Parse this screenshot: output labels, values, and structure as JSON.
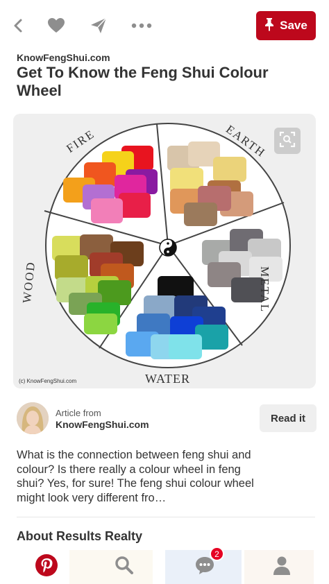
{
  "toolbar": {
    "back_icon": "chevron-left-icon",
    "like_icon": "heart-icon",
    "send_icon": "paper-plane-icon",
    "more_icon": "ellipsis-icon",
    "save_label": "Save",
    "save_icon": "pushpin-icon",
    "brand_color": "#bd081c"
  },
  "pin": {
    "source": "KnowFengShui.com",
    "title": "Get To Know the Feng Shui Colour Wheel",
    "image": {
      "labels": {
        "fire": "FIRE",
        "earth": "EARTH",
        "metal": "METAL",
        "water": "WATER",
        "wood": "WOOD"
      },
      "credit": "(c) KnowFengShui.com",
      "zoom_icon": "visual-search-icon"
    }
  },
  "author": {
    "article_from": "Article from",
    "site": "KnowFengShui.com",
    "read_label": "Read it"
  },
  "description": "What is the connection between feng shui and colour? Is there really a colour wheel in feng shui? Yes, for sure! The feng shui colour wheel might look very different fro…",
  "section": {
    "title": "About Results Realty"
  },
  "bottom_nav": {
    "home_icon": "pinterest-logo-icon",
    "search_icon": "search-icon",
    "notifications_icon": "speech-bubble-icon",
    "notifications_badge": "2",
    "profile_icon": "person-icon"
  }
}
